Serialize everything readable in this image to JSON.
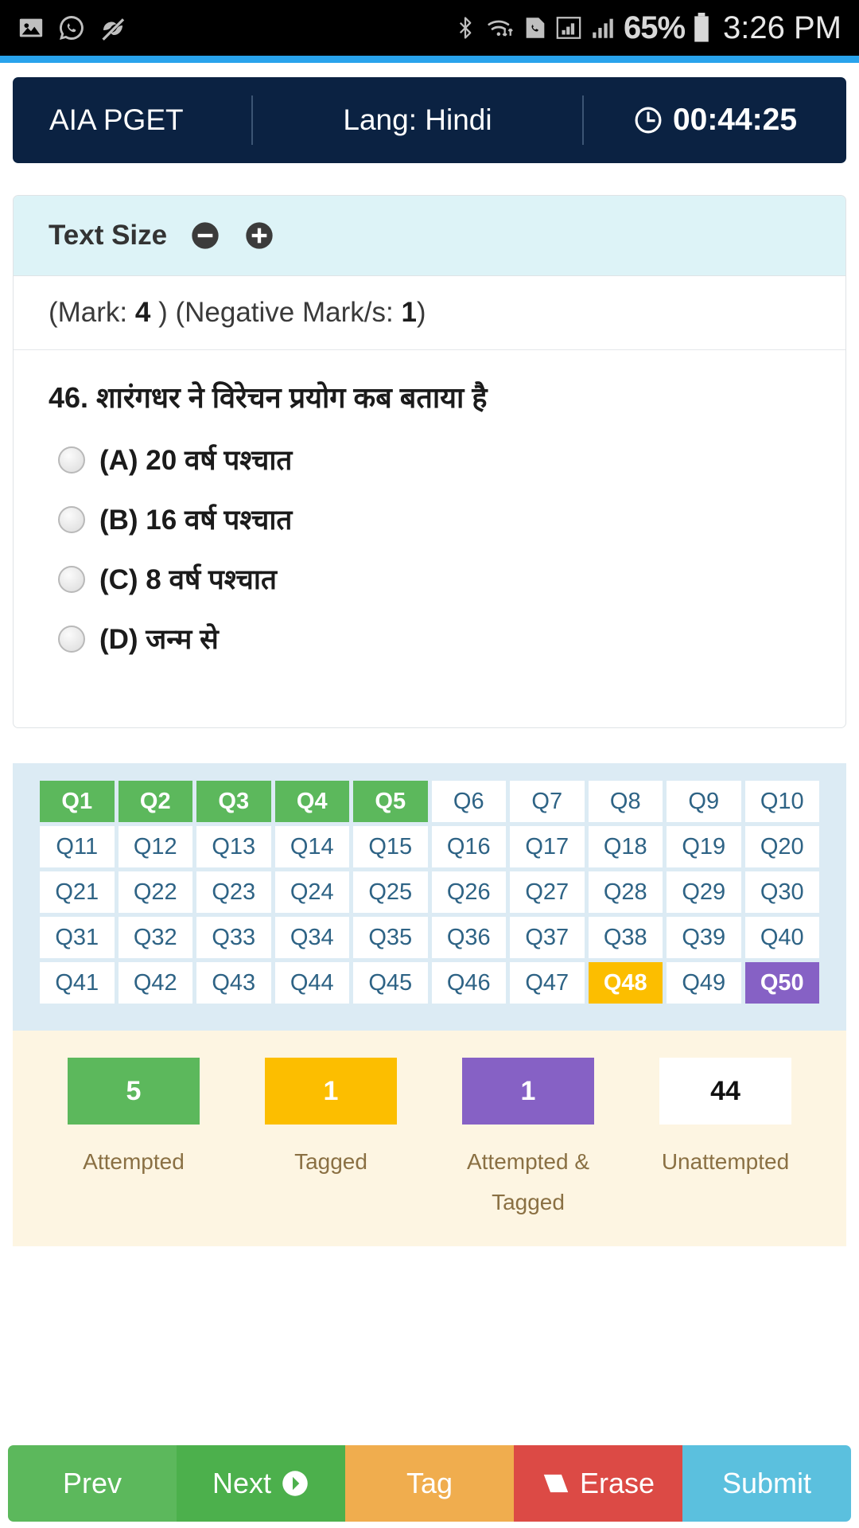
{
  "status_bar": {
    "left_icons": [
      "image-icon",
      "whatsapp-icon",
      "mute-notification-icon"
    ],
    "right_icons": [
      "bluetooth-icon",
      "wifi-icon",
      "sim-call-icon",
      "signal-bars-1-icon",
      "signal-bars-2-icon"
    ],
    "battery_percent": "65%",
    "clock": "3:26 PM"
  },
  "exam_header": {
    "title": "AIA PGET",
    "language": "Lang: Hindi",
    "timer": "00:44:25",
    "timer_icon": "clock-icon",
    "bg_color": "#0b2242"
  },
  "text_size": {
    "label": "Text Size",
    "decrease_icon": "minus-circle-icon",
    "increase_icon": "plus-circle-icon"
  },
  "marks": {
    "mark_prefix": "(Mark: ",
    "mark_value": "4",
    "mark_suffix": " )",
    "negative_prefix": "(Negative Mark/s: ",
    "negative_value": "1",
    "negative_suffix": ")"
  },
  "question": {
    "text": "46. शारंगधर ने विरेचन प्रयोग कब बताया है",
    "options": [
      {
        "label": "(A) 20 वर्ष पश्चात",
        "selected": false
      },
      {
        "label": "(B) 16 वर्ष पश्चात",
        "selected": false
      },
      {
        "label": "(C) 8 वर्ष पश्चात",
        "selected": false
      },
      {
        "label": "(D) जन्म से",
        "selected": false
      }
    ]
  },
  "palette": {
    "cells": [
      {
        "label": "Q1",
        "state": "attempted"
      },
      {
        "label": "Q2",
        "state": "attempted"
      },
      {
        "label": "Q3",
        "state": "attempted"
      },
      {
        "label": "Q4",
        "state": "attempted"
      },
      {
        "label": "Q5",
        "state": "attempted"
      },
      {
        "label": "Q6",
        "state": "unattempted"
      },
      {
        "label": "Q7",
        "state": "unattempted"
      },
      {
        "label": "Q8",
        "state": "unattempted"
      },
      {
        "label": "Q9",
        "state": "unattempted"
      },
      {
        "label": "Q10",
        "state": "unattempted"
      },
      {
        "label": "Q11",
        "state": "unattempted"
      },
      {
        "label": "Q12",
        "state": "unattempted"
      },
      {
        "label": "Q13",
        "state": "unattempted"
      },
      {
        "label": "Q14",
        "state": "unattempted"
      },
      {
        "label": "Q15",
        "state": "unattempted"
      },
      {
        "label": "Q16",
        "state": "unattempted"
      },
      {
        "label": "Q17",
        "state": "unattempted"
      },
      {
        "label": "Q18",
        "state": "unattempted"
      },
      {
        "label": "Q19",
        "state": "unattempted"
      },
      {
        "label": "Q20",
        "state": "unattempted"
      },
      {
        "label": "Q21",
        "state": "unattempted"
      },
      {
        "label": "Q22",
        "state": "unattempted"
      },
      {
        "label": "Q23",
        "state": "unattempted"
      },
      {
        "label": "Q24",
        "state": "unattempted"
      },
      {
        "label": "Q25",
        "state": "unattempted"
      },
      {
        "label": "Q26",
        "state": "unattempted"
      },
      {
        "label": "Q27",
        "state": "unattempted"
      },
      {
        "label": "Q28",
        "state": "unattempted"
      },
      {
        "label": "Q29",
        "state": "unattempted"
      },
      {
        "label": "Q30",
        "state": "unattempted"
      },
      {
        "label": "Q31",
        "state": "unattempted"
      },
      {
        "label": "Q32",
        "state": "unattempted"
      },
      {
        "label": "Q33",
        "state": "unattempted"
      },
      {
        "label": "Q34",
        "state": "unattempted"
      },
      {
        "label": "Q35",
        "state": "unattempted"
      },
      {
        "label": "Q36",
        "state": "unattempted"
      },
      {
        "label": "Q37",
        "state": "unattempted"
      },
      {
        "label": "Q38",
        "state": "unattempted"
      },
      {
        "label": "Q39",
        "state": "unattempted"
      },
      {
        "label": "Q40",
        "state": "unattempted"
      },
      {
        "label": "Q41",
        "state": "unattempted"
      },
      {
        "label": "Q42",
        "state": "unattempted"
      },
      {
        "label": "Q43",
        "state": "unattempted"
      },
      {
        "label": "Q44",
        "state": "unattempted"
      },
      {
        "label": "Q45",
        "state": "unattempted"
      },
      {
        "label": "Q46",
        "state": "unattempted"
      },
      {
        "label": "Q47",
        "state": "unattempted"
      },
      {
        "label": "Q48",
        "state": "tagged"
      },
      {
        "label": "Q49",
        "state": "unattempted"
      },
      {
        "label": "Q50",
        "state": "attempted-tagged"
      }
    ]
  },
  "legend": {
    "items": [
      {
        "count": "5",
        "label": "Attempted",
        "color": "#5cb85c"
      },
      {
        "count": "1",
        "label": "Tagged",
        "color": "#fcbe00"
      },
      {
        "count": "1",
        "label": "Attempted & Tagged",
        "color": "#8661c5"
      },
      {
        "count": "44",
        "label": "Unattempted",
        "color": "#ffffff"
      }
    ]
  },
  "buttons": {
    "prev": "Prev",
    "next": "Next",
    "next_icon": "chevron-right-circle-icon",
    "tag": "Tag",
    "erase": "Erase",
    "erase_icon": "eraser-icon",
    "submit": "Submit"
  }
}
